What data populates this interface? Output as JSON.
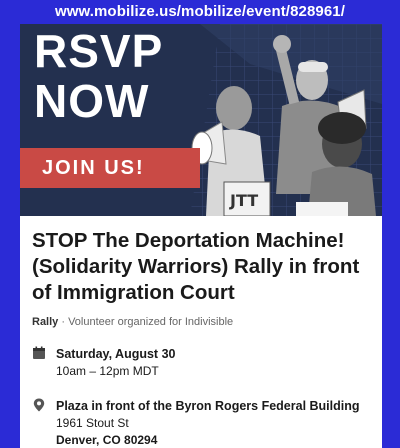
{
  "page": {
    "url": "www.mobilize.us/mobilize/event/828961/"
  },
  "banner": {
    "headline_line1": "RSVP",
    "headline_line2": "NOW",
    "cta": "JOIN US!"
  },
  "event": {
    "title": "STOP The Deportation Machine! (Solidarity Warriors) Rally in front of Immigration Court",
    "type": "Rally",
    "organizer_text": " · Volunteer organized for Indivisible",
    "date": "Saturday, August 30",
    "time": "10am – 12pm MDT",
    "location_name": "Plaza in front of the Byron Rogers Federal Building",
    "street": "1961 Stout St",
    "city": "Denver, CO 80294"
  },
  "icons": {
    "date": "calendar-icon",
    "location": "map-pin-icon"
  },
  "colors": {
    "page_bg": "#2b2bd6",
    "banner_bg": "#1f2a44",
    "cta_bg": "#c94a45"
  }
}
